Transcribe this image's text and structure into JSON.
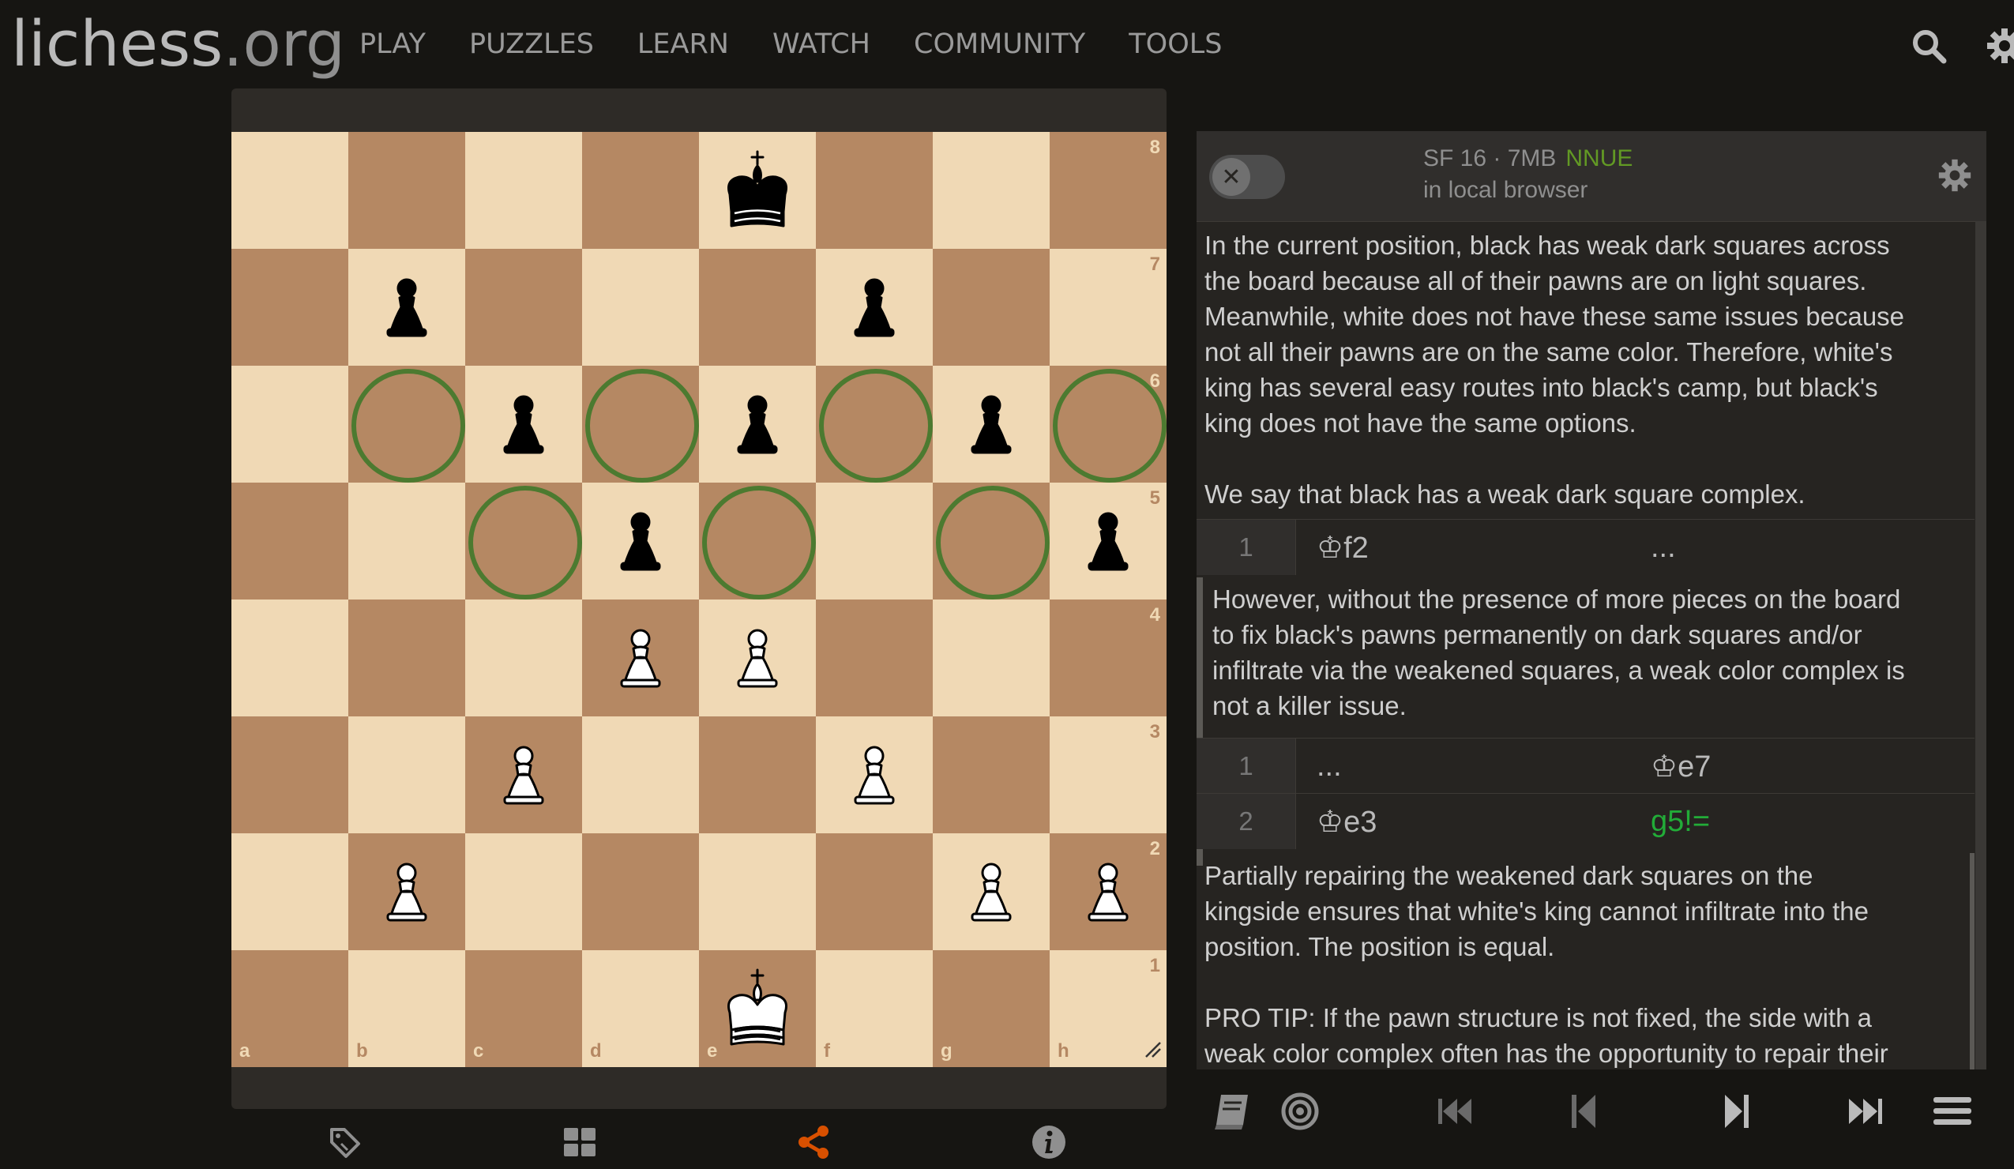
{
  "header": {
    "logo_main": "lichess",
    "logo_tld": ".org",
    "nav": [
      "PLAY",
      "PUZZLES",
      "LEARN",
      "WATCH",
      "COMMUNITY",
      "TOOLS"
    ]
  },
  "board": {
    "files": [
      "a",
      "b",
      "c",
      "d",
      "e",
      "f",
      "g",
      "h"
    ],
    "ranks": [
      "8",
      "7",
      "6",
      "5",
      "4",
      "3",
      "2",
      "1"
    ],
    "pieces": [
      {
        "square": "e8",
        "piece": "king",
        "color": "black"
      },
      {
        "square": "b7",
        "piece": "pawn",
        "color": "black"
      },
      {
        "square": "f7",
        "piece": "pawn",
        "color": "black"
      },
      {
        "square": "c6",
        "piece": "pawn",
        "color": "black"
      },
      {
        "square": "e6",
        "piece": "pawn",
        "color": "black"
      },
      {
        "square": "g6",
        "piece": "pawn",
        "color": "black"
      },
      {
        "square": "d5",
        "piece": "pawn",
        "color": "black"
      },
      {
        "square": "h5",
        "piece": "pawn",
        "color": "black"
      },
      {
        "square": "d4",
        "piece": "pawn",
        "color": "white"
      },
      {
        "square": "e4",
        "piece": "pawn",
        "color": "white"
      },
      {
        "square": "c3",
        "piece": "pawn",
        "color": "white"
      },
      {
        "square": "f3",
        "piece": "pawn",
        "color": "white"
      },
      {
        "square": "b2",
        "piece": "pawn",
        "color": "white"
      },
      {
        "square": "g2",
        "piece": "pawn",
        "color": "white"
      },
      {
        "square": "h2",
        "piece": "pawn",
        "color": "white"
      },
      {
        "square": "e1",
        "piece": "king",
        "color": "white"
      }
    ],
    "highlighted_squares": [
      "b6",
      "d6",
      "f6",
      "h6",
      "c5",
      "e5",
      "g5"
    ],
    "highlight_color": "#4c7a30",
    "light_color": "#f0d9b5",
    "dark_color": "#b58863"
  },
  "under_board_icons": [
    "tag-icon",
    "grid-icon",
    "share-icon",
    "info-icon"
  ],
  "engine": {
    "name": "SF 16 · 7MB",
    "nnue": "NNUE",
    "location": "in local browser",
    "toggle_symbol": "✕"
  },
  "analysis": {
    "comment1": "In the current position, black has weak dark squares across\nthe board because all of their pawns are on light squares.\nMeanwhile, white does not have these same issues because\nnot all their pawns are on the same color. Therefore, white's\nking has several easy routes into black's camp, but black's\nking does not have the same options.\n\nWe say that black has a weak dark square complex.",
    "move1": {
      "num": "1",
      "white": "♔f2",
      "black": "..."
    },
    "comment2": "However, without the presence of more pieces on the board\nto fix black's pawns permanently on dark squares and/or\ninfiltrate via the weakened squares, a weak color complex is\nnot a killer issue.",
    "move2": {
      "num": "1",
      "white": "...",
      "black": "♔e7"
    },
    "move3": {
      "num": "2",
      "white": "♔e3",
      "black": "g5!="
    },
    "comment3": "Partially repairing the weakened dark squares on the\nkingside ensures that white's king cannot infiltrate into the\nposition. The position is equal.\n\nPRO TIP: If the pawn structure is not fixed, the side with a\nweak color complex often has the opportunity to repair their"
  },
  "controls": [
    "book-icon",
    "target-icon",
    "first-move-icon",
    "prev-move-icon",
    "next-move-icon",
    "last-move-icon",
    "menu-icon"
  ],
  "colors": {
    "accent_orange": "#d85000",
    "good_move": "#22ac38",
    "nnue_green": "#629924"
  }
}
